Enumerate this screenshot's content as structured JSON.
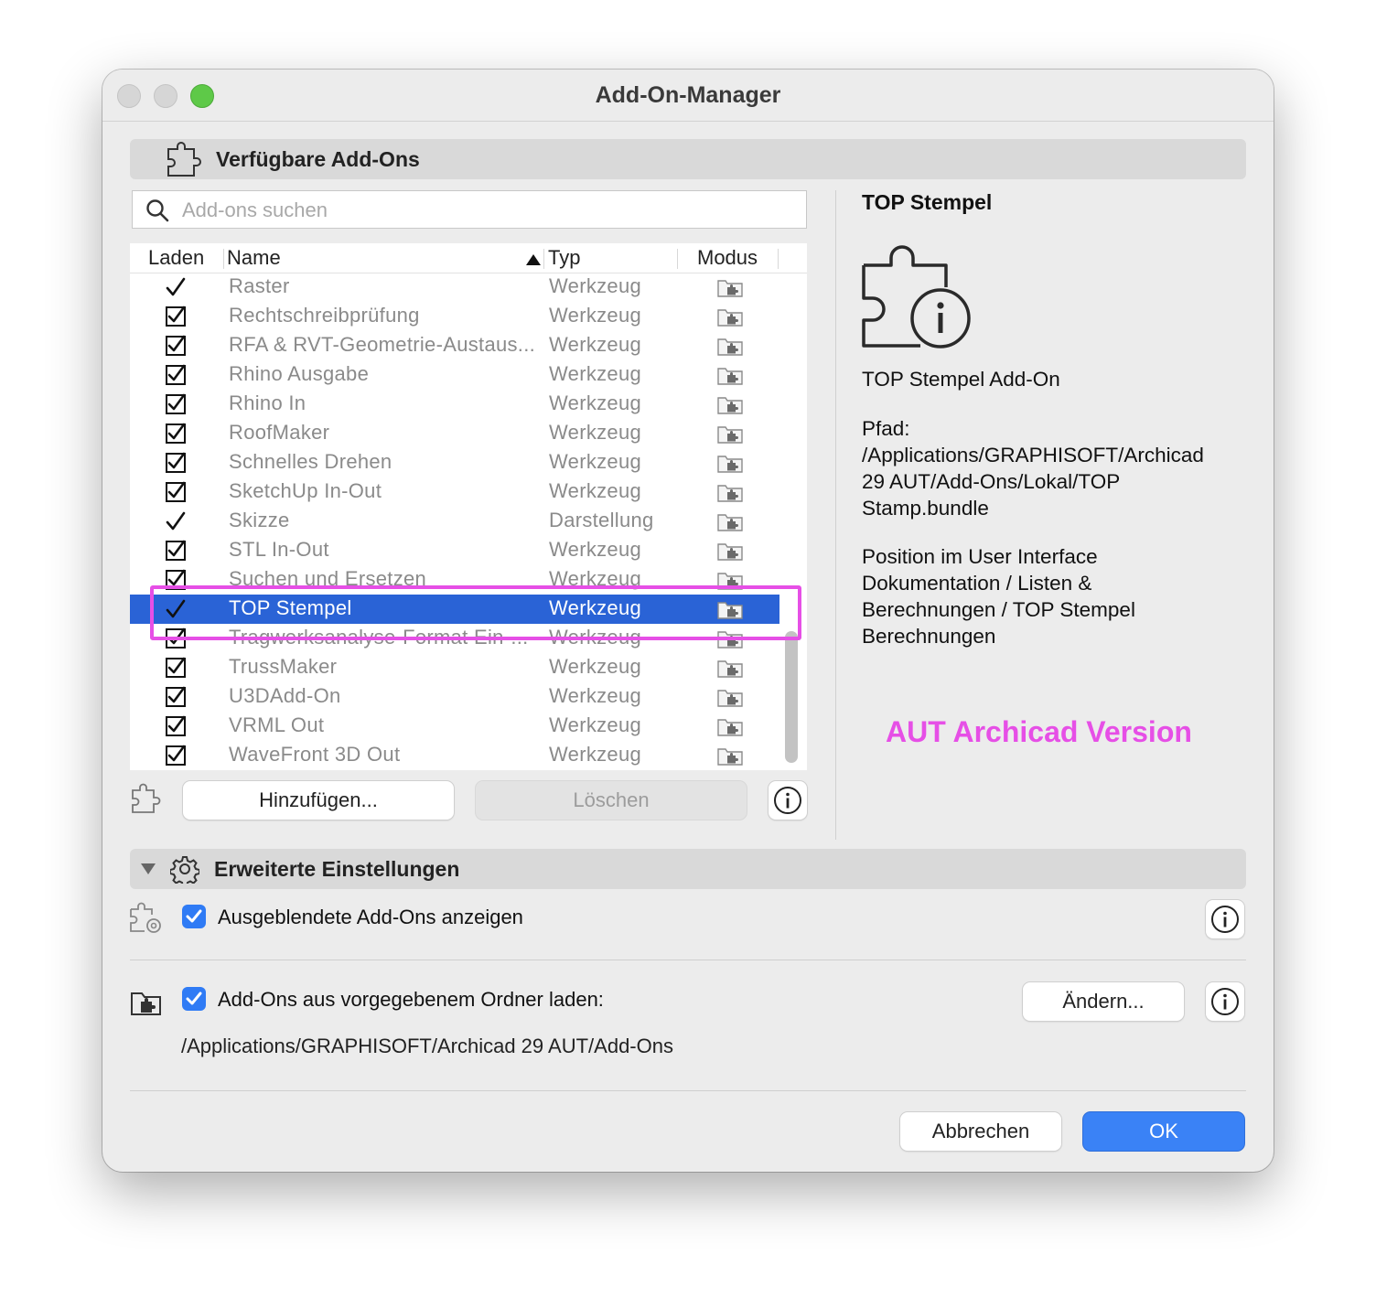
{
  "window": {
    "title": "Add-On-Manager"
  },
  "available": {
    "header": "Verfügbare Add-Ons",
    "search_placeholder": "Add-ons suchen",
    "columns": {
      "load": "Laden",
      "name": "Name",
      "type": "Typ",
      "mode": "Modus"
    },
    "rows": [
      {
        "name": "Raster",
        "type": "Werkzeug",
        "check": "tick"
      },
      {
        "name": "Rechtschreibprüfung",
        "type": "Werkzeug",
        "check": "box"
      },
      {
        "name": "RFA & RVT-Geometrie-Austaus...",
        "type": "Werkzeug",
        "check": "box"
      },
      {
        "name": "Rhino Ausgabe",
        "type": "Werkzeug",
        "check": "box"
      },
      {
        "name": "Rhino In",
        "type": "Werkzeug",
        "check": "box"
      },
      {
        "name": "RoofMaker",
        "type": "Werkzeug",
        "check": "box"
      },
      {
        "name": "Schnelles Drehen",
        "type": "Werkzeug",
        "check": "box"
      },
      {
        "name": "SketchUp In-Out",
        "type": "Werkzeug",
        "check": "box"
      },
      {
        "name": "Skizze",
        "type": "Darstellung",
        "check": "tick"
      },
      {
        "name": "STL In-Out",
        "type": "Werkzeug",
        "check": "box"
      },
      {
        "name": "Suchen und Ersetzen",
        "type": "Werkzeug",
        "check": "box"
      },
      {
        "name": "TOP Stempel",
        "type": "Werkzeug",
        "check": "tick",
        "selected": true
      },
      {
        "name": "Tragwerksanalyse-Format Ein-...",
        "type": "Werkzeug",
        "check": "box"
      },
      {
        "name": "TrussMaker",
        "type": "Werkzeug",
        "check": "box"
      },
      {
        "name": "U3DAdd-On",
        "type": "Werkzeug",
        "check": "box"
      },
      {
        "name": "VRML Out",
        "type": "Werkzeug",
        "check": "box"
      },
      {
        "name": "WaveFront 3D Out",
        "type": "Werkzeug",
        "check": "box"
      }
    ],
    "add_button": "Hinzufügen...",
    "delete_button": "Löschen"
  },
  "detail": {
    "title": "TOP Stempel",
    "description": "TOP Stempel Add-On",
    "path_label": "Pfad:",
    "path_lines": [
      "/Applications/GRAPHISOFT/Archicad",
      "29 AUT/Add-Ons/Lokal/TOP",
      "Stamp.bundle"
    ],
    "position_lines": [
      "Position im User Interface",
      "Dokumentation / Listen &",
      "Berechnungen / TOP Stempel",
      "Berechnungen"
    ],
    "annotation": "AUT Archicad Version"
  },
  "advanced": {
    "header": "Erweiterte Einstellungen",
    "show_hidden_label": "Ausgeblendete Add-Ons anzeigen",
    "load_folder_label": "Add-Ons aus vorgegebenem Ordner laden:",
    "change_button": "Ändern...",
    "folder_path": "/Applications/GRAPHISOFT/Archicad 29 AUT/Add-Ons"
  },
  "footer": {
    "cancel": "Abbrechen",
    "ok": "OK"
  },
  "colors": {
    "selection": "#2a63d6",
    "accent": "#3a82f6",
    "highlight": "#e64fe6"
  }
}
